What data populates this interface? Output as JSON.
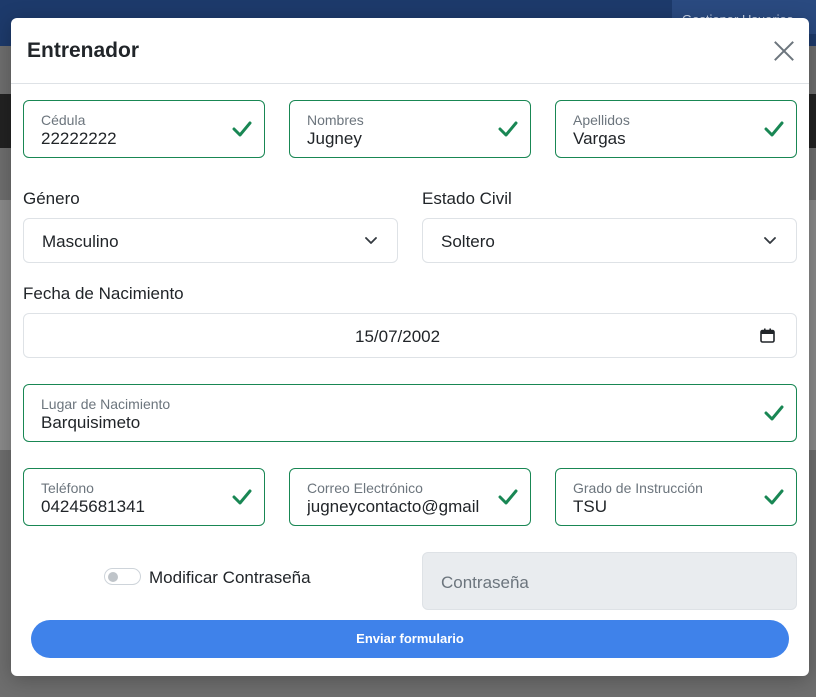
{
  "background": {
    "user_menu": "Gestionar Usuarios"
  },
  "modal": {
    "title": "Entrenador",
    "fields": {
      "cedula": {
        "label": "Cédula",
        "value": "22222222"
      },
      "nombres": {
        "label": "Nombres",
        "value": "Jugney"
      },
      "apellidos": {
        "label": "Apellidos",
        "value": "Vargas"
      },
      "genero": {
        "label": "Género",
        "value": "Masculino"
      },
      "estado_civil": {
        "label": "Estado Civil",
        "value": "Soltero"
      },
      "fecha_nacimiento": {
        "label": "Fecha de Nacimiento",
        "value": "15/07/2002"
      },
      "lugar_nacimiento": {
        "label": "Lugar de Nacimiento",
        "value": "Barquisimeto"
      },
      "telefono": {
        "label": "Teléfono",
        "value": "04245681341"
      },
      "correo": {
        "label": "Correo Electrónico",
        "value": "jugneycontacto@gmail"
      },
      "grado_instruccion": {
        "label": "Grado de Instrucción",
        "value": "TSU"
      }
    },
    "password": {
      "toggle_label": "Modificar Contraseña",
      "toggle_on": false,
      "placeholder": "Contraseña"
    },
    "submit_label": "Enviar formulario"
  },
  "colors": {
    "valid": "#198754",
    "primary": "#3f82ea",
    "navbar": "#1d3a6b"
  },
  "icons": [
    "close-icon",
    "check-icon",
    "chevron-down-icon",
    "calendar-icon"
  ]
}
